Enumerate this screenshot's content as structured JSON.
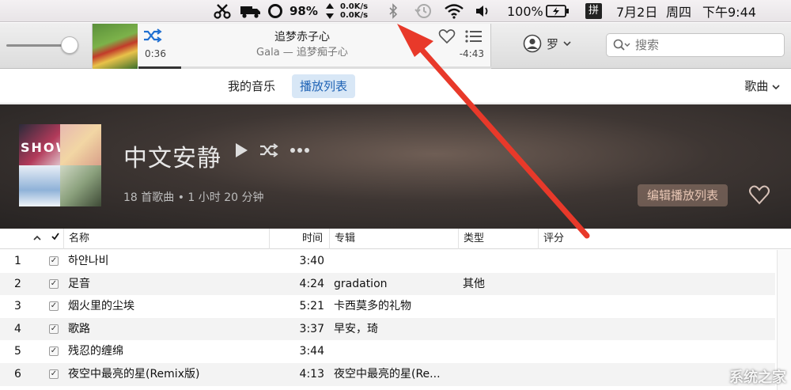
{
  "menubar": {
    "battery_ring_pct": "98%",
    "net_up": "0.0K/s",
    "net_down": "0.0K/s",
    "battery_pct": "100%",
    "input_method": "拼",
    "date": "7月2日",
    "weekday": "周四",
    "time": "下午9:44",
    "icons": [
      "scissors-icon",
      "truck-icon",
      "ring-icon",
      "updown-icon",
      "bluetooth-icon",
      "time-machine-icon",
      "wifi-icon",
      "volume-icon",
      "battery-icon"
    ]
  },
  "player": {
    "song_title": "追梦赤子心",
    "song_subtitle": "Gala — 追梦痴子心",
    "elapsed": "0:36",
    "remaining": "-4:43",
    "progress": 0.12
  },
  "user": {
    "name": "罗"
  },
  "search": {
    "placeholder": "搜索"
  },
  "nav": {
    "tabs": [
      {
        "label": "我的音乐",
        "active": false
      },
      {
        "label": "播放列表",
        "active": true
      }
    ],
    "view_dropdown": "歌曲"
  },
  "playlist": {
    "title": "中文安静",
    "meta": "18 首歌曲 • 1 小时 20 分钟",
    "edit_label": "编辑播放列表",
    "collage_text": "SHOW"
  },
  "table": {
    "columns": [
      "名称",
      "时间",
      "专辑",
      "类型",
      "评分"
    ],
    "rows": [
      {
        "num": "1",
        "name": "하얀나비",
        "time": "3:40",
        "album": "",
        "genre": ""
      },
      {
        "num": "2",
        "name": "足音",
        "time": "4:24",
        "album": "gradation",
        "genre": "其他"
      },
      {
        "num": "3",
        "name": "烟火里的尘埃",
        "time": "5:21",
        "album": "卡西莫多的礼物",
        "genre": ""
      },
      {
        "num": "4",
        "name": "歌路",
        "time": "3:37",
        "album": "早安，琦",
        "genre": ""
      },
      {
        "num": "5",
        "name": "残忍的缠绵",
        "time": "3:44",
        "album": "",
        "genre": ""
      },
      {
        "num": "6",
        "name": "夜空中最亮的星(Remix版)",
        "time": "4:13",
        "album": "夜空中最亮的星(Re...",
        "genre": ""
      }
    ]
  },
  "watermark": "系统之家",
  "colors": {
    "accent": "#1f63b5",
    "arrow": "#e8392a"
  }
}
